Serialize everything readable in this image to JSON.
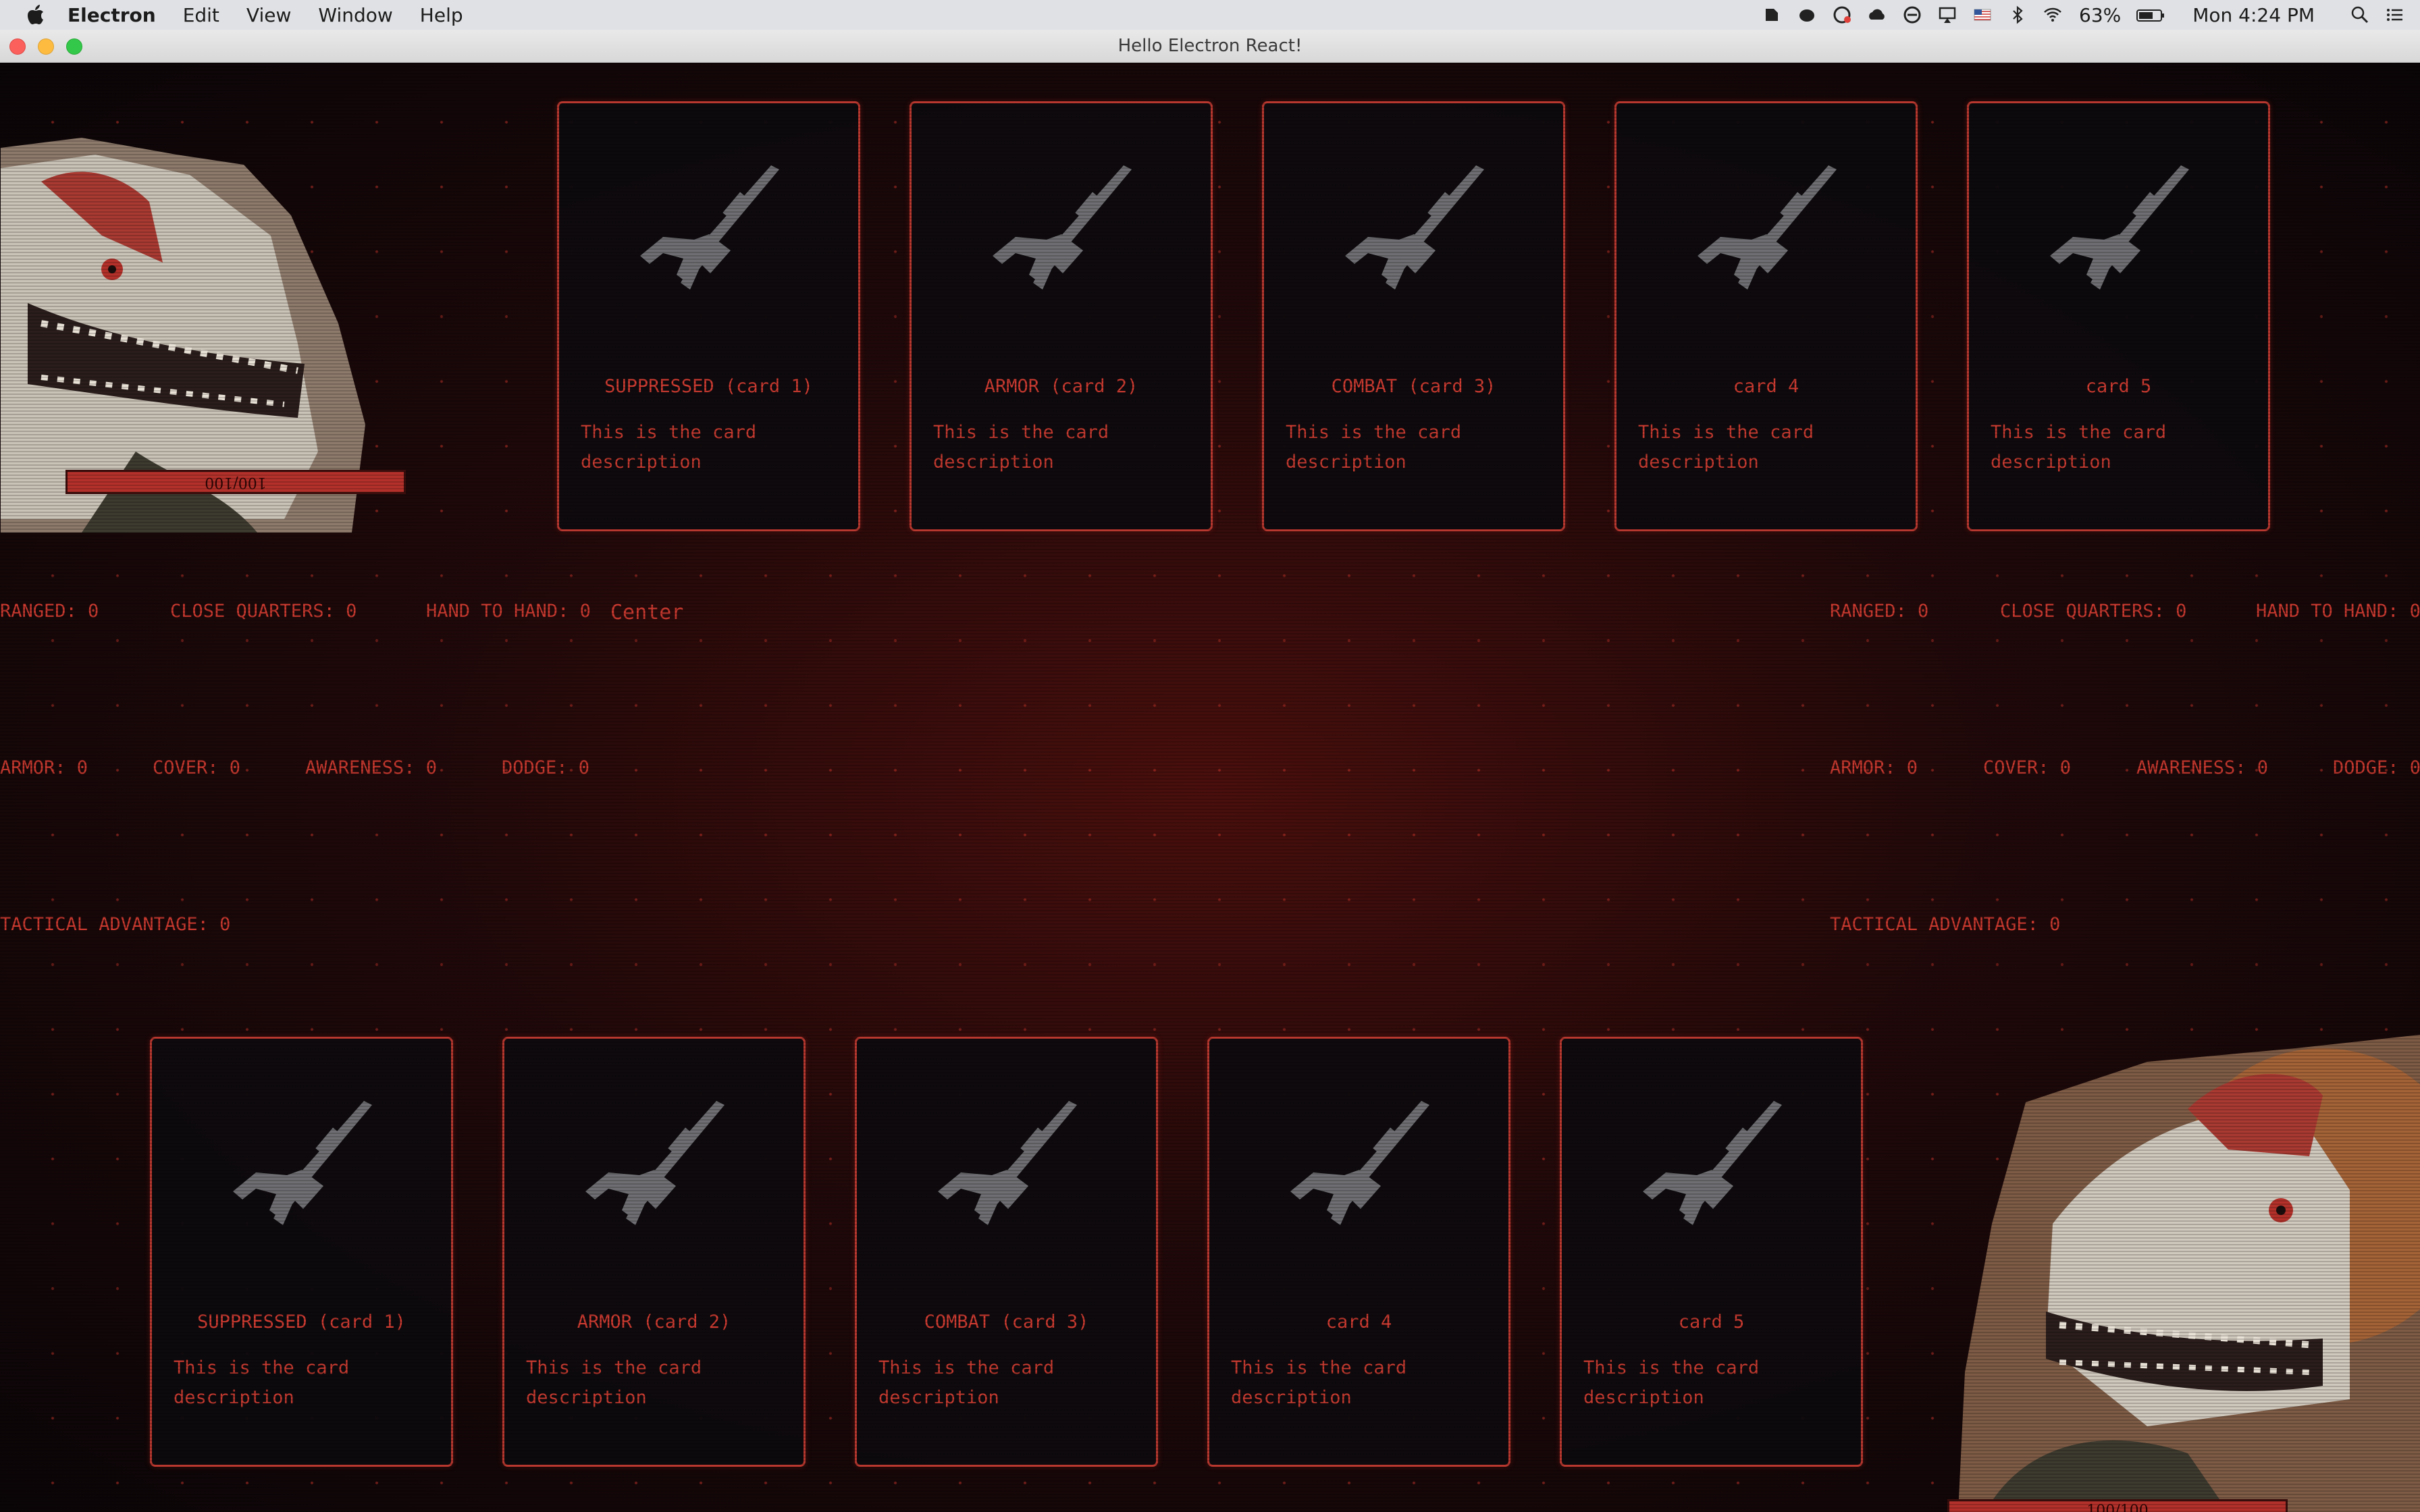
{
  "menubar": {
    "app_name": "Electron",
    "menus": [
      "Edit",
      "View",
      "Window",
      "Help"
    ],
    "battery": "63%",
    "clock": "Mon 4:24 PM"
  },
  "window": {
    "title": "Hello Electron React!"
  },
  "player": {
    "hp": "100/100",
    "cards": [
      {
        "title": "SUPPRESSED (card 1)",
        "description": "This is the card description"
      },
      {
        "title": "ARMOR (card 2)",
        "description": "This is the card description"
      },
      {
        "title": "COMBAT (card 3)",
        "description": "This is the card description"
      },
      {
        "title": "card 4",
        "description": "This is the card description"
      },
      {
        "title": "card 5",
        "description": "This is the card description"
      }
    ],
    "stats": {
      "ranged": "RANGED: 0",
      "close_quarters": "CLOSE QUARTERS: 0",
      "hand_to_hand": "HAND TO HAND: 0",
      "armor": "ARMOR: 0",
      "cover": "COVER: 0",
      "awareness": "AWARENESS: 0",
      "dodge": "DODGE: 0",
      "tactical_advantage": "TACTICAL ADVANTAGE: 0"
    }
  },
  "center_label": "Center",
  "enemy": {
    "hp": "100/100",
    "cards": [
      {
        "title": "SUPPRESSED (card 1)",
        "description": "This is the card description"
      },
      {
        "title": "ARMOR (card 2)",
        "description": "This is the card description"
      },
      {
        "title": "COMBAT (card 3)",
        "description": "This is the card description"
      },
      {
        "title": "card 4",
        "description": "This is the card description"
      },
      {
        "title": "card 5",
        "description": "This is the card description"
      }
    ],
    "stats": {
      "ranged": "RANGED: 0",
      "close_quarters": "CLOSE QUARTERS: 0",
      "hand_to_hand": "HAND TO HAND: 0",
      "armor": "ARMOR: 0",
      "cover": "COVER: 0",
      "awareness": "AWARENESS: 0",
      "dodge": "DODGE: 0",
      "tactical_advantage": "TACTICAL ADVANTAGE: 0"
    }
  },
  "colors": {
    "accent": "#c8392f",
    "card_border": "#b8382f",
    "hp_bar": "#b4312b",
    "background": "#0c0709"
  },
  "icons": {
    "card_art": "rifle-icon",
    "portrait": "dinosaur-soldier-portrait"
  }
}
